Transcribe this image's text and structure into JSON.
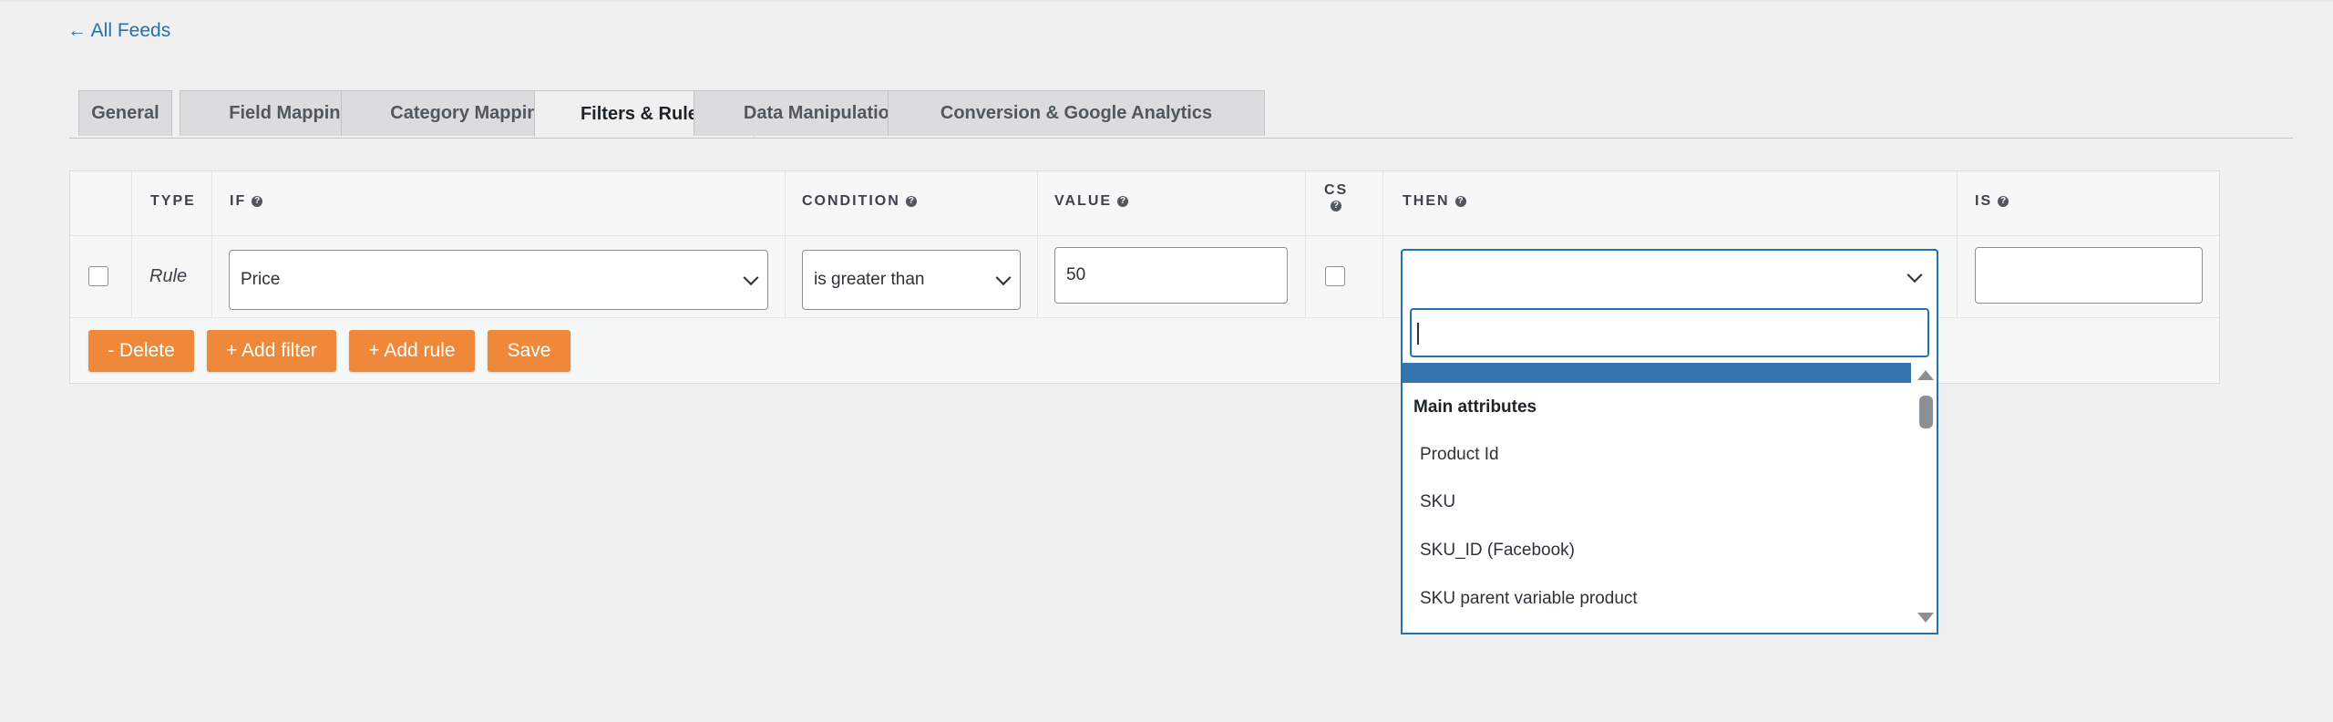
{
  "back_link": "← All Feeds",
  "tabs": [
    {
      "label": "General"
    },
    {
      "label": "Field Mapping"
    },
    {
      "label": "Category Mapping"
    },
    {
      "label": "Filters & Rules",
      "active": true
    },
    {
      "label": "Data Manipulation"
    },
    {
      "label": "Conversion & Google Analytics"
    }
  ],
  "table": {
    "headers": {
      "type": "TYPE",
      "if": "IF",
      "condition": "CONDITION",
      "value": "VALUE",
      "cs": "CS",
      "then": "THEN",
      "is": "IS"
    },
    "row": {
      "type": "Rule",
      "if_value": "Price",
      "condition_value": "is greater than",
      "value": "50",
      "then_value": "",
      "is_value": ""
    }
  },
  "buttons": {
    "delete": "- Delete",
    "add_filter": "+ Add filter",
    "add_rule": "+ Add rule",
    "save": "Save"
  },
  "dropdown": {
    "search_value": "",
    "group": "Main attributes",
    "items": [
      "Product Id",
      "SKU",
      "SKU_ID (Facebook)",
      "SKU parent variable product"
    ]
  },
  "colors": {
    "accent": "#2271b1",
    "button": "#f0883a",
    "highlight": "#3474b0"
  }
}
